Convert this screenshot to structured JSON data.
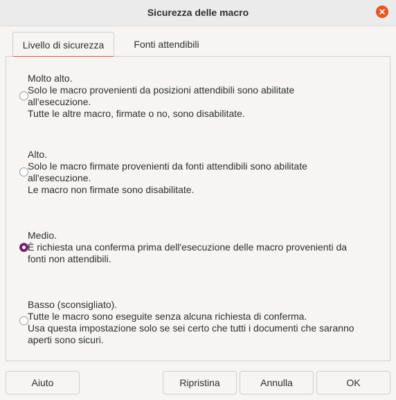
{
  "window": {
    "title": "Sicurezza delle macro"
  },
  "tabs": [
    {
      "label": "Livello di sicurezza",
      "active": true
    },
    {
      "label": "Fonti attendibili",
      "active": false
    }
  ],
  "options": [
    {
      "lines": [
        "Molto alto.",
        "Solo le macro provenienti da posizioni attendibili sono abilitate",
        "all'esecuzione.",
        "Tutte le altre macro, firmate o no, sono disabilitate."
      ],
      "selected": false
    },
    {
      "lines": [
        "Alto.",
        "Solo le macro firmate provenienti da fonti attendibili sono abilitate",
        "all'esecuzione.",
        "Le macro non firmate sono disabilitate."
      ],
      "selected": false
    },
    {
      "lines": [
        "Medio.",
        "È richiesta una conferma prima dell'esecuzione delle macro provenienti da",
        "fonti non attendibili."
      ],
      "selected": true
    },
    {
      "lines": [
        "Basso (sconsigliato).",
        "Tutte le macro sono eseguite senza alcuna richiesta di conferma.",
        "Usa questa impostazione solo se sei certo che tutti i documenti che saranno",
        "aperti sono sicuri."
      ],
      "selected": false
    }
  ],
  "buttons": {
    "help": "Aiuto",
    "reset": "Ripristina",
    "cancel": "Annulla",
    "ok": "OK"
  },
  "colors": {
    "accent": "#e95420",
    "radio_selected": "#77216f"
  },
  "icons": {
    "close": "close-icon"
  }
}
